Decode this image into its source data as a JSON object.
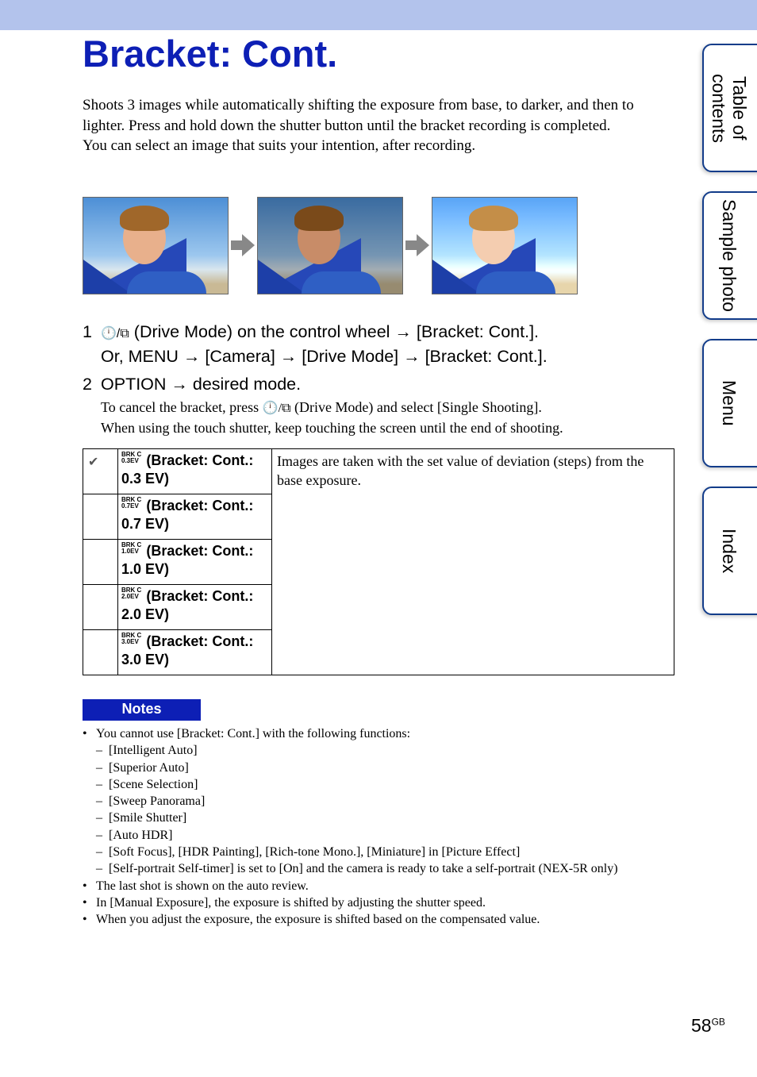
{
  "title": "Bracket: Cont.",
  "intro": [
    "Shoots 3 images while automatically shifting the exposure from base, to darker, and then to lighter. Press and hold down the shutter button until the bracket recording is completed.",
    "You can select an image that suits your intention, after recording."
  ],
  "steps": {
    "s1_num": "1",
    "s1_icon": "self-timer / continuous icon",
    "s1_text": "(Drive Mode) on the control wheel → [Bracket: Cont.].",
    "s1_alt": "Or, MENU → [Camera] → [Drive Mode] → [Bracket: Cont.].",
    "s2_num": "2",
    "s2_text": "OPTION → desired mode.",
    "sub1a": "To cancel the bracket, press",
    "sub1b": "(Drive Mode) and select [Single Shooting].",
    "sub2": "When using the touch shutter, keep touching the screen until the end of shooting."
  },
  "table": {
    "rows": [
      {
        "icon": "BRK C 0.3EV",
        "label": "(Bracket: Cont.: 0.3 EV)",
        "selected": true
      },
      {
        "icon": "BRK C 0.7EV",
        "label": "(Bracket: Cont.: 0.7 EV)"
      },
      {
        "icon": "BRK C 1.0EV",
        "label": "(Bracket: Cont.: 1.0 EV)"
      },
      {
        "icon": "BRK C 2.0EV",
        "label": "(Bracket: Cont.: 2.0 EV)"
      },
      {
        "icon": "BRK C 3.0EV",
        "label": "(Bracket: Cont.: 3.0 EV)"
      }
    ],
    "description": "Images are taken with the set value of deviation (steps) from the base exposure."
  },
  "notes": {
    "heading": "Notes",
    "b1": "You cannot use [Bracket: Cont.] with the following functions:",
    "dashes": [
      "[Intelligent Auto]",
      "[Superior Auto]",
      "[Scene Selection]",
      "[Sweep Panorama]",
      "[Smile Shutter]",
      "[Auto HDR]",
      "[Soft Focus], [HDR Painting], [Rich-tone Mono.], [Miniature] in [Picture Effect]",
      "[Self-portrait Self-timer] is set to [On] and the camera is ready to take a self-portrait (NEX-5R only)"
    ],
    "b2": "The last shot is shown on the auto review.",
    "b3": "In [Manual Exposure], the exposure is shifted by adjusting the shutter speed.",
    "b4": "When you adjust the exposure, the exposure is shifted based on the compensated value."
  },
  "tabs": [
    "Table of contents",
    "Sample photo",
    "Menu",
    "Index"
  ],
  "page": {
    "number": "58",
    "suffix": "GB"
  },
  "colors": {
    "title": "#0d1fb5",
    "topbar": "#b3c3ec",
    "tab_border": "#123c8a"
  }
}
